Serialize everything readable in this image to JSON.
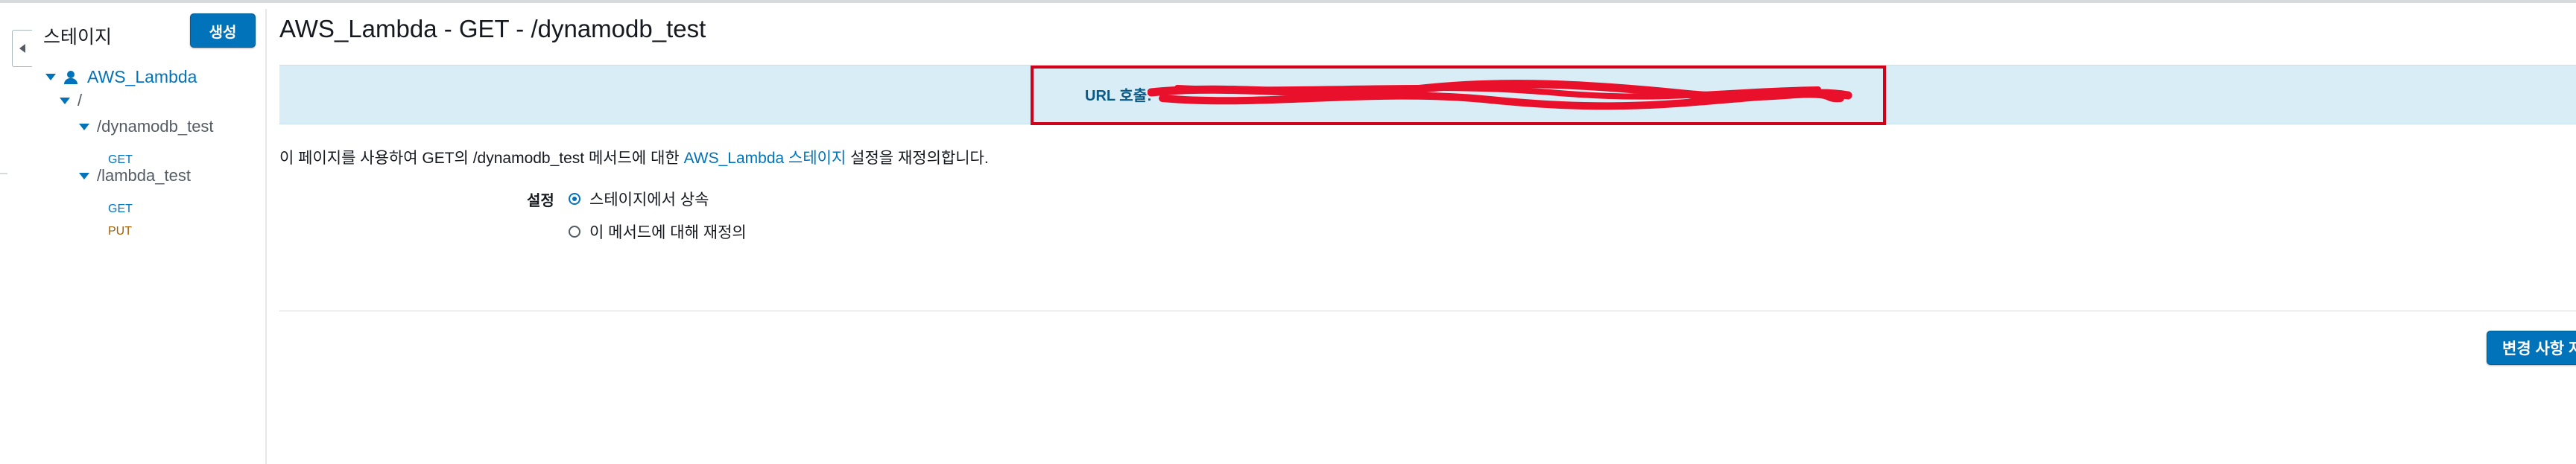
{
  "sidebar": {
    "title": "스테이지",
    "create_label": "생성",
    "stage_name": "AWS_Lambda",
    "root": "/",
    "resources": [
      {
        "path": "/dynamodb_test",
        "methods": [
          "GET"
        ]
      },
      {
        "path": "/lambda_test",
        "methods": [
          "GET",
          "PUT"
        ]
      }
    ]
  },
  "main": {
    "title": "AWS_Lambda - GET - /dynamodb_test",
    "invoke_url_label": "URL 호출:",
    "description": {
      "prefix": "이 페이지를 사용하여 GET의 /dynamodb_test 메서드에 대한 ",
      "link": "AWS_Lambda 스테이지",
      "suffix": " 설정을 재정의합니다."
    },
    "settings_label": "설정",
    "options": [
      {
        "label": "스테이지에서 상속",
        "selected": true
      },
      {
        "label": "이 메서드에 대해 재정의",
        "selected": false
      }
    ],
    "save_label": "변경 사항 저장"
  },
  "colors": {
    "accent": "#0073bb",
    "banner": "#d9edf7",
    "highlight": "#d0021b",
    "redaction": "#e8102a",
    "put_method": "#a15d00"
  },
  "icons": [
    "collapse-arrow-icon",
    "stage-icon",
    "expand-triangle-icon"
  ]
}
